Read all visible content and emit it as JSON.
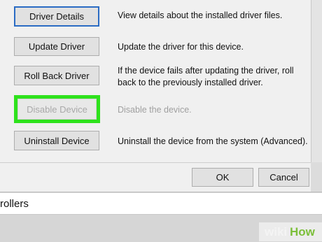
{
  "buttons": {
    "driver_details": "Driver Details",
    "update_driver": "Update Driver",
    "roll_back_driver": "Roll Back Driver",
    "disable_device": "Disable Device",
    "uninstall_device": "Uninstall Device",
    "ok": "OK",
    "cancel": "Cancel"
  },
  "descriptions": {
    "driver_details": "View details about the installed driver files.",
    "update_driver": "Update the driver for this device.",
    "roll_back_line1": "If the device fails after updating the driver, roll",
    "roll_back_line2": "back to the previously installed driver.",
    "disable_device": "Disable the device.",
    "uninstall_device": "Uninstall the device from the system (Advanced)."
  },
  "background_window": {
    "partial_item": "rollers"
  },
  "watermark": {
    "wiki": "wiki",
    "how": "How"
  },
  "colors": {
    "highlight": "#2ee21c",
    "focus_border": "#2b6cc4",
    "disabled_text": "#a9a9a9"
  }
}
